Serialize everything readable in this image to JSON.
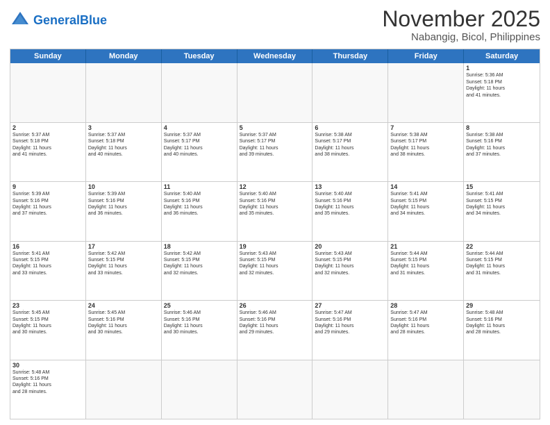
{
  "header": {
    "logo_general": "General",
    "logo_blue": "Blue",
    "month_title": "November 2025",
    "location": "Nabangig, Bicol, Philippines"
  },
  "day_headers": [
    "Sunday",
    "Monday",
    "Tuesday",
    "Wednesday",
    "Thursday",
    "Friday",
    "Saturday"
  ],
  "weeks": [
    [
      {
        "num": "",
        "info": ""
      },
      {
        "num": "",
        "info": ""
      },
      {
        "num": "",
        "info": ""
      },
      {
        "num": "",
        "info": ""
      },
      {
        "num": "",
        "info": ""
      },
      {
        "num": "",
        "info": ""
      },
      {
        "num": "1",
        "info": "Sunrise: 5:36 AM\nSunset: 5:18 PM\nDaylight: 11 hours\nand 41 minutes."
      }
    ],
    [
      {
        "num": "2",
        "info": "Sunrise: 5:37 AM\nSunset: 5:18 PM\nDaylight: 11 hours\nand 41 minutes."
      },
      {
        "num": "3",
        "info": "Sunrise: 5:37 AM\nSunset: 5:18 PM\nDaylight: 11 hours\nand 40 minutes."
      },
      {
        "num": "4",
        "info": "Sunrise: 5:37 AM\nSunset: 5:17 PM\nDaylight: 11 hours\nand 40 minutes."
      },
      {
        "num": "5",
        "info": "Sunrise: 5:37 AM\nSunset: 5:17 PM\nDaylight: 11 hours\nand 39 minutes."
      },
      {
        "num": "6",
        "info": "Sunrise: 5:38 AM\nSunset: 5:17 PM\nDaylight: 11 hours\nand 38 minutes."
      },
      {
        "num": "7",
        "info": "Sunrise: 5:38 AM\nSunset: 5:17 PM\nDaylight: 11 hours\nand 38 minutes."
      },
      {
        "num": "8",
        "info": "Sunrise: 5:38 AM\nSunset: 5:16 PM\nDaylight: 11 hours\nand 37 minutes."
      }
    ],
    [
      {
        "num": "9",
        "info": "Sunrise: 5:39 AM\nSunset: 5:16 PM\nDaylight: 11 hours\nand 37 minutes."
      },
      {
        "num": "10",
        "info": "Sunrise: 5:39 AM\nSunset: 5:16 PM\nDaylight: 11 hours\nand 36 minutes."
      },
      {
        "num": "11",
        "info": "Sunrise: 5:40 AM\nSunset: 5:16 PM\nDaylight: 11 hours\nand 36 minutes."
      },
      {
        "num": "12",
        "info": "Sunrise: 5:40 AM\nSunset: 5:16 PM\nDaylight: 11 hours\nand 35 minutes."
      },
      {
        "num": "13",
        "info": "Sunrise: 5:40 AM\nSunset: 5:16 PM\nDaylight: 11 hours\nand 35 minutes."
      },
      {
        "num": "14",
        "info": "Sunrise: 5:41 AM\nSunset: 5:15 PM\nDaylight: 11 hours\nand 34 minutes."
      },
      {
        "num": "15",
        "info": "Sunrise: 5:41 AM\nSunset: 5:15 PM\nDaylight: 11 hours\nand 34 minutes."
      }
    ],
    [
      {
        "num": "16",
        "info": "Sunrise: 5:41 AM\nSunset: 5:15 PM\nDaylight: 11 hours\nand 33 minutes."
      },
      {
        "num": "17",
        "info": "Sunrise: 5:42 AM\nSunset: 5:15 PM\nDaylight: 11 hours\nand 33 minutes."
      },
      {
        "num": "18",
        "info": "Sunrise: 5:42 AM\nSunset: 5:15 PM\nDaylight: 11 hours\nand 32 minutes."
      },
      {
        "num": "19",
        "info": "Sunrise: 5:43 AM\nSunset: 5:15 PM\nDaylight: 11 hours\nand 32 minutes."
      },
      {
        "num": "20",
        "info": "Sunrise: 5:43 AM\nSunset: 5:15 PM\nDaylight: 11 hours\nand 32 minutes."
      },
      {
        "num": "21",
        "info": "Sunrise: 5:44 AM\nSunset: 5:15 PM\nDaylight: 11 hours\nand 31 minutes."
      },
      {
        "num": "22",
        "info": "Sunrise: 5:44 AM\nSunset: 5:15 PM\nDaylight: 11 hours\nand 31 minutes."
      }
    ],
    [
      {
        "num": "23",
        "info": "Sunrise: 5:45 AM\nSunset: 5:15 PM\nDaylight: 11 hours\nand 30 minutes."
      },
      {
        "num": "24",
        "info": "Sunrise: 5:45 AM\nSunset: 5:16 PM\nDaylight: 11 hours\nand 30 minutes."
      },
      {
        "num": "25",
        "info": "Sunrise: 5:46 AM\nSunset: 5:16 PM\nDaylight: 11 hours\nand 30 minutes."
      },
      {
        "num": "26",
        "info": "Sunrise: 5:46 AM\nSunset: 5:16 PM\nDaylight: 11 hours\nand 29 minutes."
      },
      {
        "num": "27",
        "info": "Sunrise: 5:47 AM\nSunset: 5:16 PM\nDaylight: 11 hours\nand 29 minutes."
      },
      {
        "num": "28",
        "info": "Sunrise: 5:47 AM\nSunset: 5:16 PM\nDaylight: 11 hours\nand 28 minutes."
      },
      {
        "num": "29",
        "info": "Sunrise: 5:48 AM\nSunset: 5:16 PM\nDaylight: 11 hours\nand 28 minutes."
      }
    ],
    [
      {
        "num": "30",
        "info": "Sunrise: 5:48 AM\nSunset: 5:16 PM\nDaylight: 11 hours\nand 28 minutes."
      },
      {
        "num": "",
        "info": ""
      },
      {
        "num": "",
        "info": ""
      },
      {
        "num": "",
        "info": ""
      },
      {
        "num": "",
        "info": ""
      },
      {
        "num": "",
        "info": ""
      },
      {
        "num": "",
        "info": ""
      }
    ]
  ]
}
